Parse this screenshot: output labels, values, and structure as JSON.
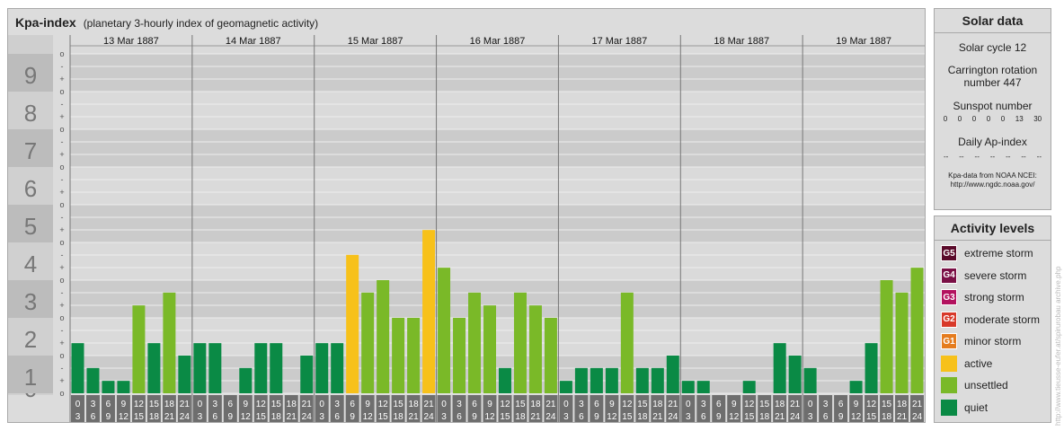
{
  "header": {
    "title": "Kpa-index",
    "subtitle": "(planetary 3-hourly index of geomagnetic activity)"
  },
  "y_axis": {
    "major_labels": [
      "0",
      "1",
      "2",
      "3",
      "4",
      "5",
      "6",
      "7",
      "8",
      "9"
    ],
    "minor_marks": [
      "o",
      "+",
      "-"
    ]
  },
  "days": [
    "13 Mar 1887",
    "14 Mar 1887",
    "15 Mar 1887",
    "16 Mar 1887",
    "17 Mar 1887",
    "18 Mar 1887",
    "19 Mar 1887"
  ],
  "interval_labels": [
    [
      "0",
      "3"
    ],
    [
      "3",
      "6"
    ],
    [
      "6",
      "9"
    ],
    [
      "9",
      "12"
    ],
    [
      "12",
      "15"
    ],
    [
      "15",
      "18"
    ],
    [
      "18",
      "21"
    ],
    [
      "21",
      "24"
    ]
  ],
  "chart_data": {
    "type": "bar",
    "title": "Kpa-index",
    "subtitle": "(planetary 3-hourly index of geomagnetic activity)",
    "ylim": [
      0,
      9.33
    ],
    "grid": true,
    "values": [
      1.33,
      0.67,
      0.33,
      0.33,
      2.33,
      1.33,
      2.67,
      1.0,
      1.33,
      1.33,
      0.0,
      0.67,
      1.33,
      1.33,
      0.0,
      1.0,
      1.33,
      1.33,
      3.67,
      2.67,
      3.0,
      2.0,
      2.0,
      4.33,
      3.33,
      2.0,
      2.67,
      2.33,
      0.67,
      2.67,
      2.33,
      2.0,
      0.33,
      0.67,
      0.67,
      0.67,
      2.67,
      0.67,
      0.67,
      1.0,
      0.33,
      0.33,
      0.0,
      0.0,
      0.33,
      0.0,
      1.33,
      1.0,
      0.67,
      0.0,
      0.0,
      0.33,
      1.33,
      3.0,
      2.67,
      3.33
    ],
    "colors": {
      "quiet": "#0a8a45",
      "unsettled": "#7ab928",
      "active": "#f7c11a"
    }
  },
  "solar": {
    "heading": "Solar data",
    "cycle": "Solar cycle 12",
    "carrington": "Carrington rotation number 447",
    "sunspot_label": "Sunspot number",
    "sunspots": [
      "0",
      "0",
      "0",
      "0",
      "0",
      "13",
      "30"
    ],
    "ap_label": "Daily Ap-index",
    "ap_values": [
      "--",
      "--",
      "--",
      "--",
      "--",
      "--",
      "--"
    ],
    "source1": "Kpa-data from NOAA NCEI:",
    "source2": "http://www.ngdc.noaa.gov/"
  },
  "activity": {
    "heading": "Activity levels",
    "levels": [
      {
        "badge": "G5",
        "label": "extreme storm",
        "color": "#5a0a2a"
      },
      {
        "badge": "G4",
        "label": "severe storm",
        "color": "#7a0f45"
      },
      {
        "badge": "G3",
        "label": "strong storm",
        "color": "#b3125f"
      },
      {
        "badge": "G2",
        "label": "moderate storm",
        "color": "#d8392a"
      },
      {
        "badge": "G1",
        "label": "minor storm",
        "color": "#e57c1e"
      },
      {
        "badge": "",
        "label": "active",
        "color": "#f7c11a"
      },
      {
        "badge": "",
        "label": "unsettled",
        "color": "#7ab928"
      },
      {
        "badge": "",
        "label": "quiet",
        "color": "#0a8a45"
      }
    ]
  },
  "credit": "http://www.tieusse-eufer.at/spirurobau archive.php"
}
